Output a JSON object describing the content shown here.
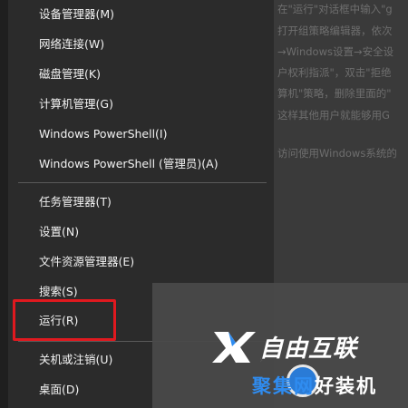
{
  "background_page": {
    "lines": [
      "在\"运行\"对话框中输入\"g",
      "打开组策略编辑器，依次",
      "→Windows设置→安全设",
      "户权利指派\"，双击\"拒绝",
      "算机\"策略，删除里面的\"",
      "这样其他用户就能够用G",
      "访问使用Windows系统的"
    ]
  },
  "menu": {
    "group1": [
      {
        "label": "设备管理器(M)"
      },
      {
        "label": "网络连接(W)"
      },
      {
        "label": "磁盘管理(K)"
      },
      {
        "label": "计算机管理(G)"
      },
      {
        "label": "Windows PowerShell(I)"
      },
      {
        "label": "Windows PowerShell (管理员)(A)"
      }
    ],
    "group2": [
      {
        "label": "任务管理器(T)"
      },
      {
        "label": "设置(N)"
      },
      {
        "label": "文件资源管理器(E)"
      },
      {
        "label": "搜索(S)"
      },
      {
        "label": "运行(R)"
      }
    ],
    "group3": [
      {
        "label": "关机或注销(U)"
      },
      {
        "label": "桌面(D)"
      }
    ]
  },
  "watermark": {
    "top_text": "自由互联",
    "bottom_blue": "聚集网",
    "bottom_white": "好装机"
  },
  "colors": {
    "menu_bg": "#2b2b2b",
    "highlight": "#e0191f",
    "accent_blue": "#2f8cf0"
  }
}
